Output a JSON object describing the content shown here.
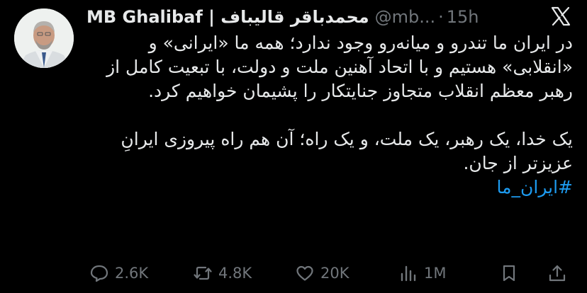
{
  "author": {
    "name": "MB Ghalibaf | محمدباقر قالیباف",
    "handle": "@mb...",
    "separator": "·",
    "time": "15h"
  },
  "post": {
    "paragraph1": "در ایران ما تندرو و میانه‌رو وجود ندارد؛ همه ما «ایرانی» و «انقلابی» هستیم و با اتحاد آهنین ملت و دولت، با تبعیت کامل از رهبر معظم انقلاب متجاوز جنایتکار را پشیمان خواهیم کرد.",
    "paragraph2": "یک خدا، یک رهبر، یک ملت، و یک راه؛ آن هم راه پیروزی ایرانِ عزیزتر از جان.",
    "hashtag": "#ایران_ما"
  },
  "actions": {
    "replies": "2.6K",
    "reposts": "4.8K",
    "likes": "20K",
    "views": "1M"
  },
  "icons": [
    "x-logo-icon",
    "reply-icon",
    "repost-icon",
    "like-icon",
    "views-icon",
    "bookmark-icon",
    "share-icon"
  ],
  "colors": {
    "accent": "#1d9bf0",
    "muted": "#71767b",
    "text": "#e7e9ea",
    "background": "#000000"
  }
}
